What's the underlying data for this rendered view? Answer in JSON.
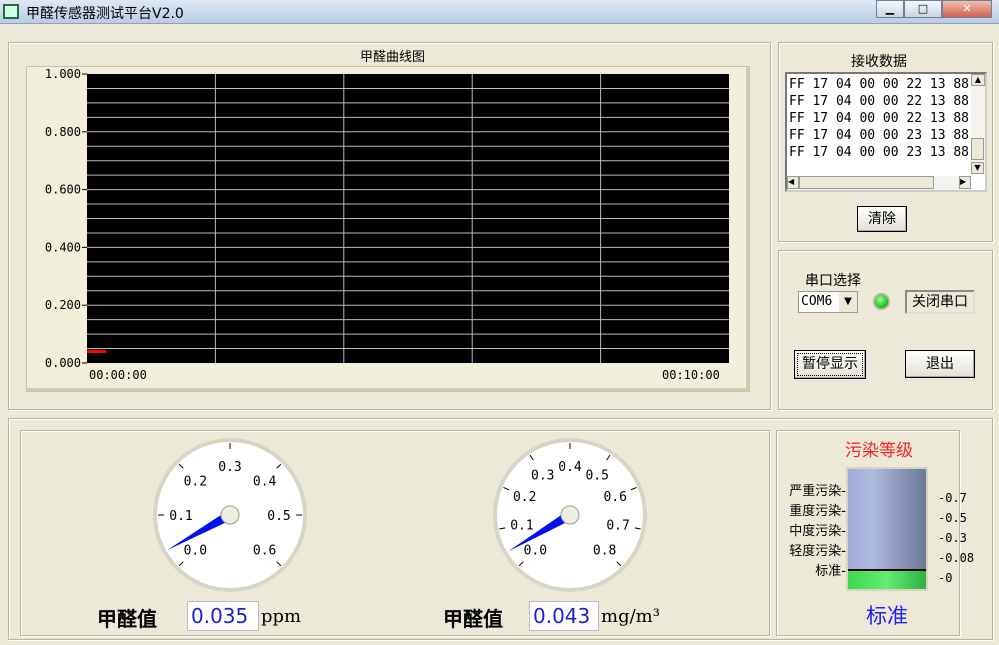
{
  "window": {
    "title": "甲醛传感器测试平台V2.0",
    "minimize": "▁",
    "maximize": "□",
    "close": "✕"
  },
  "chart": {
    "title": "甲醛曲线图",
    "x_labels": [
      "00:00:00",
      "00:10:00"
    ],
    "chart_data": {
      "type": "line",
      "ylim": [
        0,
        1
      ],
      "yticks": [
        "1.000",
        "0.800",
        "0.600",
        "0.400",
        "0.200",
        "0.000"
      ],
      "xlim": [
        "00:00:00",
        "00:10:00"
      ],
      "grid": true,
      "series": [
        {
          "color": "#ff0000",
          "x": [
            0,
            0.3
          ],
          "y": [
            0.04,
            0.04
          ]
        }
      ]
    }
  },
  "receive": {
    "title": "接收数据",
    "lines": [
      "FF 17 04 00 00 22 13 88",
      "FF 17 04 00 00 22 13 88",
      "FF 17 04 00 00 22 13 88",
      "FF 17 04 00 00 23 13 88",
      "FF 17 04 00 00 23 13 88"
    ],
    "clear_label": "清除"
  },
  "serial": {
    "title": "串口选择",
    "port": "COM6",
    "status_color": "#22cc22",
    "close_label": "关闭串口",
    "pause_label": "暂停显示",
    "exit_label": "退出"
  },
  "gauge1": {
    "label": "甲醛值",
    "value": "0.035",
    "unit": "ppm",
    "ticks": [
      "0.0",
      "0.1",
      "0.2",
      "0.3",
      "0.4",
      "0.5",
      "0.6"
    ],
    "min": 0,
    "max": 0.6
  },
  "gauge2": {
    "label": "甲醛值",
    "value": "0.043",
    "unit": "mg/m³",
    "ticks": [
      "0.0",
      "0.1",
      "0.2",
      "0.3",
      "0.4",
      "0.5",
      "0.6",
      "0.7",
      "0.8"
    ],
    "min": 0,
    "max": 0.8
  },
  "level": {
    "title": "污染等级",
    "levels": [
      "严重污染",
      "重度污染",
      "中度污染",
      "轻度污染",
      "标准"
    ],
    "scale": [
      "0.7",
      "0.5",
      "0.3",
      "0.08",
      "0"
    ],
    "current": "标准",
    "fill_fraction": 0.17,
    "title_color": "#ff2020",
    "current_color": "#2020ff"
  }
}
